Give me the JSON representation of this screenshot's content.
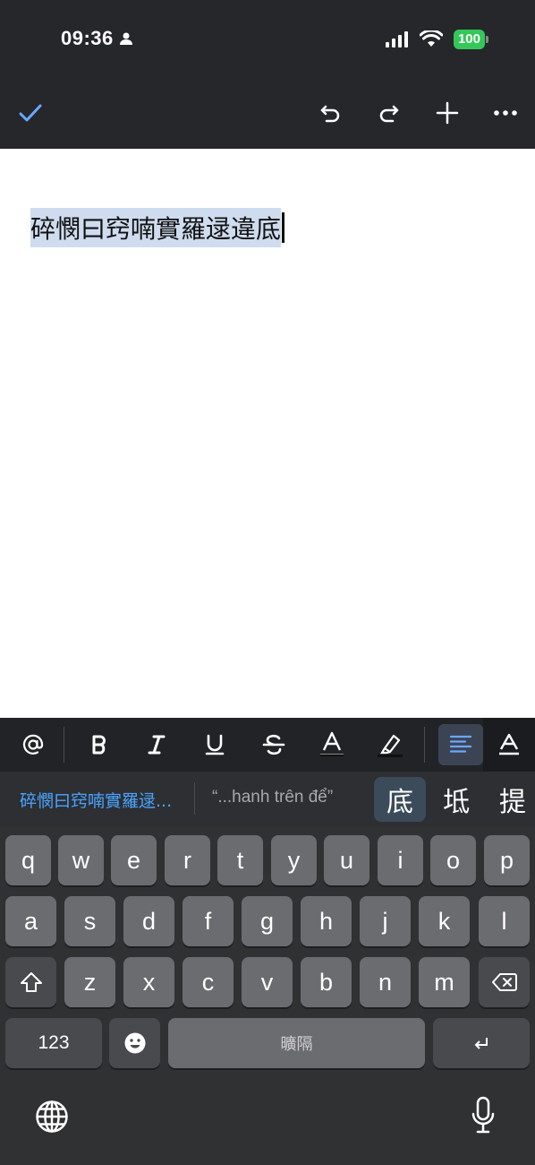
{
  "status": {
    "time": "09:36",
    "battery": "100"
  },
  "document": {
    "text": "碎憫曰窍喃實羅逯違底"
  },
  "candidates": {
    "primary": "碎憫曰窍喃實羅逯...",
    "quote": "“...hanh trên để”",
    "items": [
      "底",
      "坻",
      "提"
    ]
  },
  "keyboard": {
    "row1": [
      "q",
      "w",
      "e",
      "r",
      "t",
      "y",
      "u",
      "i",
      "o",
      "p"
    ],
    "row2": [
      "a",
      "s",
      "d",
      "f",
      "g",
      "h",
      "j",
      "k",
      "l"
    ],
    "row3": [
      "z",
      "x",
      "c",
      "v",
      "b",
      "n",
      "m"
    ],
    "numbers_label": "123",
    "space_label": "曠隔"
  },
  "format_bar": {
    "icons": [
      "mention-icon",
      "bold-icon",
      "italic-icon",
      "underline-icon",
      "strikethrough-icon",
      "text-color-icon",
      "highlight-icon",
      "align-left-icon",
      "text-format-icon"
    ]
  }
}
